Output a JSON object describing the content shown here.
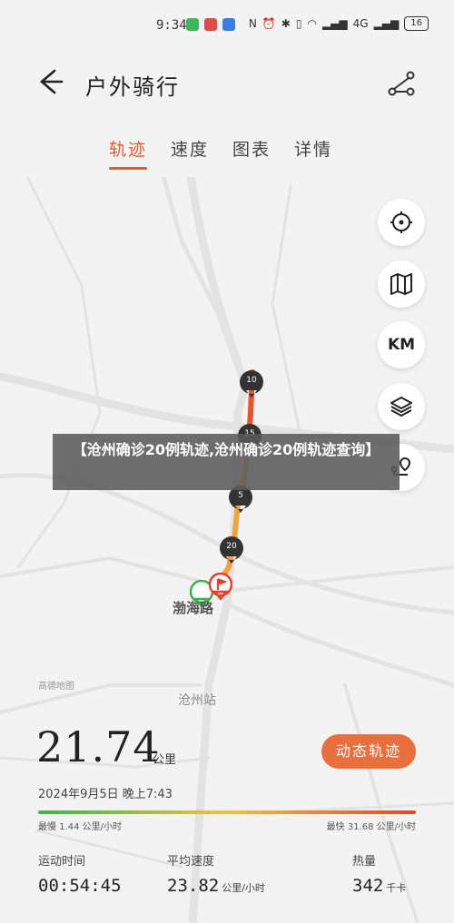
{
  "status": {
    "time": "9:34",
    "battery": "16",
    "network": "4G"
  },
  "header": {
    "title": "户外骑行"
  },
  "tabs": [
    {
      "label": "轨迹"
    },
    {
      "label": "速度"
    },
    {
      "label": "图表"
    },
    {
      "label": "详情"
    }
  ],
  "map_controls": {
    "km_label": "KM"
  },
  "map": {
    "markers": [
      "10",
      "15",
      "5",
      "20"
    ],
    "road_label": "渤海路",
    "station_label": "沧州站",
    "attribution": "高德地图"
  },
  "banner": {
    "text": "【沧州确诊20例轨迹,沧州确诊20例轨迹查询】"
  },
  "summary": {
    "distance": "21.74",
    "distance_unit": "公里",
    "animate_button": "动态轨迹",
    "datetime": "2024年9月5日 晚上7:43",
    "slowest": "最慢 1.44 公里/小时",
    "fastest": "最快 31.68 公里/小时"
  },
  "stats": [
    {
      "label": "运动时间",
      "value": "00:54:45",
      "unit": ""
    },
    {
      "label": "平均速度",
      "value": "23.82",
      "unit": "公里/小时"
    },
    {
      "label": "热量",
      "value": "342",
      "unit": "千卡"
    }
  ],
  "colors": {
    "accent": "#e25a2c",
    "button": "#e96f3e",
    "track_start": "#f7b731",
    "track_end": "#e25a2c"
  }
}
